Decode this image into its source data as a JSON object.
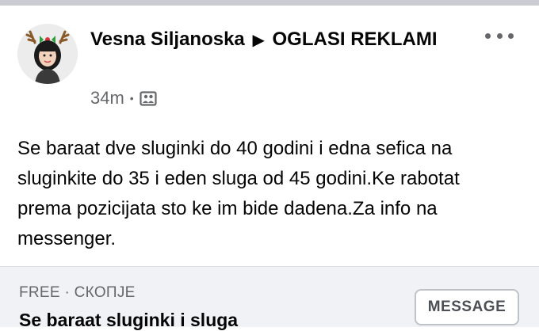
{
  "post": {
    "author": "Vesna Siljanoska",
    "arrow_glyph": "▶",
    "group": "OGLASI REKLAMI",
    "time": "34m",
    "separator": "•",
    "audience_icon": "group-photo-icon",
    "more_icon": "more-options-icon",
    "text": "Se baraat dve sluginki do 40 godini i edna sefica na sluginkite do 35 i eden sluga od 45 godini.Ke rabotat prema pozicijata sto ke im bide dadena.Za info na messenger."
  },
  "listing": {
    "meta": "FREE · СКОПЈЕ",
    "title": "Se baraat sluginki i sluga",
    "message_label": "MESSAGE"
  },
  "colors": {
    "text_primary": "#050505",
    "text_secondary": "#65676b",
    "listing_bg": "#f0f2f5",
    "divider": "#c9ccd1"
  }
}
